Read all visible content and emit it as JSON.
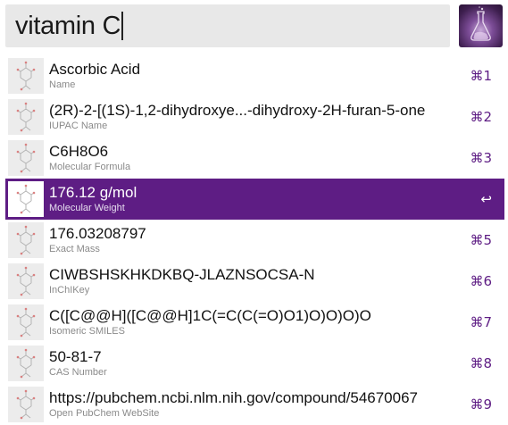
{
  "search": {
    "query": "vitamin C"
  },
  "results": [
    {
      "title": "Ascorbic Acid",
      "subtitle": "Name",
      "shortcut": "⌘1"
    },
    {
      "title": "(2R)-2-[(1S)-1,2-dihydroxye...-dihydroxy-2H-furan-5-one",
      "subtitle": "IUPAC Name",
      "shortcut": "⌘2"
    },
    {
      "title": "C6H8O6",
      "subtitle": "Molecular Formula",
      "shortcut": "⌘3"
    },
    {
      "title": "176.12 g/mol",
      "subtitle": "Molecular Weight",
      "shortcut": "↩"
    },
    {
      "title": "176.03208797",
      "subtitle": "Exact Mass",
      "shortcut": "⌘5"
    },
    {
      "title": "CIWBSHSKHKDKBQ-JLAZNSOCSA-N",
      "subtitle": "InChIKey",
      "shortcut": "⌘6"
    },
    {
      "title": "C([C@@H]([C@@H]1C(=C(C(=O)O1)O)O)O)O",
      "subtitle": "Isomeric SMILES",
      "shortcut": "⌘7"
    },
    {
      "title": "50-81-7",
      "subtitle": "CAS Number",
      "shortcut": "⌘8"
    },
    {
      "title": "https://pubchem.ncbi.nlm.nih.gov/compound/54670067",
      "subtitle": "Open PubChem WebSite",
      "shortcut": "⌘9"
    }
  ],
  "colors": {
    "accent": "#5e1d84",
    "search_bg": "#e8e8e8",
    "subtitle": "#8a8a8a"
  },
  "icons": {
    "app": "flask-icon",
    "result": "molecule-structure-icon"
  }
}
